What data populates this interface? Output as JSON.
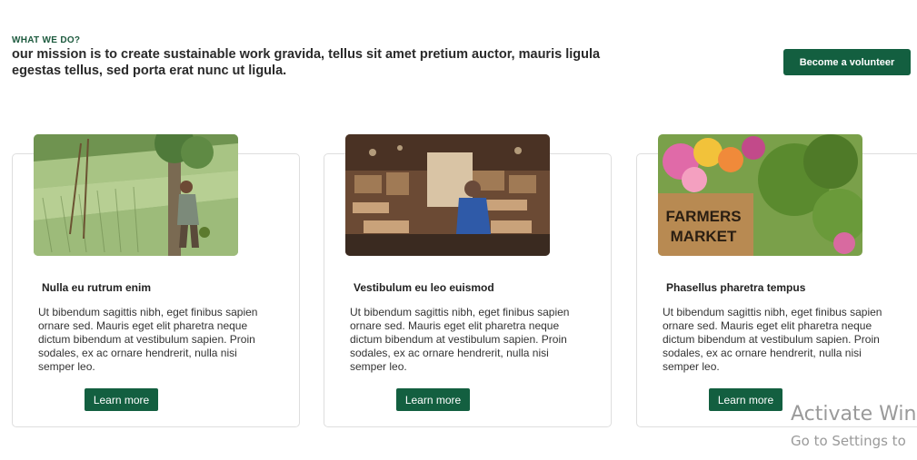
{
  "header": {
    "eyebrow": "WHAT WE DO?",
    "mission": "our mission is to create sustainable work gravida, tellus sit amet pretium auctor, mauris ligula egestas tellus, sed porta erat nunc ut ligula.",
    "volunteer_label": "Become a volunteer"
  },
  "cards": [
    {
      "title": "Nulla eu rutrum enim",
      "text": "Ut bibendum sagittis nibh, eget finibus sapien ornare sed. Mauris eget elit pharetra neque dictum bibendum at vestibulum sapien. Proin sodales, ex ac ornare hendrerit, nulla nisi semper leo.",
      "button": "Learn more"
    },
    {
      "title": "Vestibulum eu leo euismod",
      "text": "Ut bibendum sagittis nibh, eget finibus sapien ornare sed. Mauris eget elit pharetra neque dictum bibendum at vestibulum sapien. Proin sodales, ex ac ornare hendrerit, nulla nisi semper leo.",
      "button": "Learn more"
    },
    {
      "title": "Phasellus pharetra tempus",
      "text": "Ut bibendum sagittis nibh, eget finibus sapien ornare sed. Mauris eget elit pharetra neque dictum bibendum at vestibulum sapien. Proin sodales, ex ac ornare hendrerit, nulla nisi semper leo.",
      "button": "Learn more",
      "image_sign": "FARMERS MARKET"
    }
  ],
  "watermark": {
    "line1": "Activate Win",
    "line2": "Go to Settings to"
  },
  "colors": {
    "accent": "#135f40",
    "eyebrow": "#1d5a3e"
  }
}
